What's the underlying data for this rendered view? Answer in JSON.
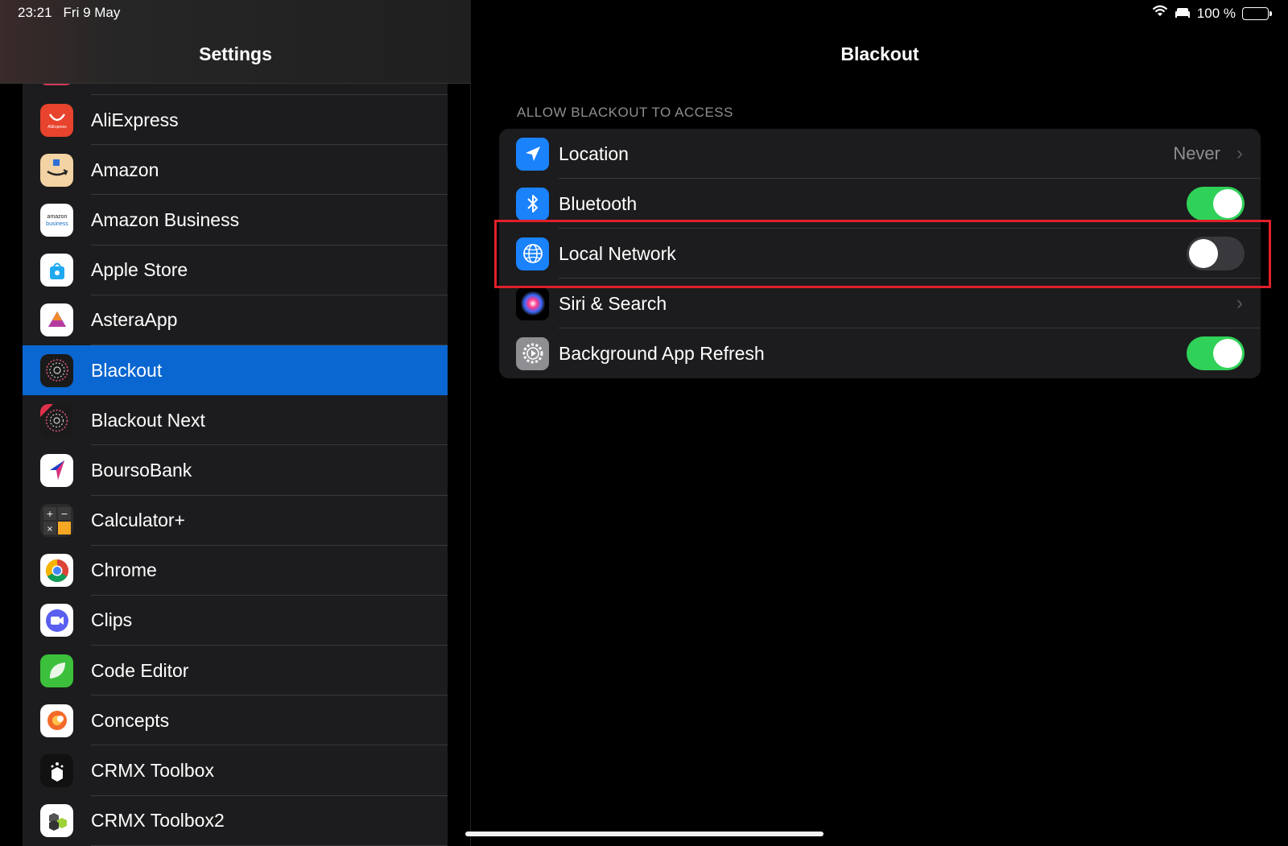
{
  "status_bar": {
    "time": "23:21",
    "date": "Fri 9 May",
    "battery_text": "100 %"
  },
  "sidebar": {
    "title": "Settings",
    "items": [
      {
        "label": "AliExpress",
        "icon": "aliexpress-icon",
        "color": "#e8432d"
      },
      {
        "label": "Amazon",
        "icon": "amazon-icon",
        "color": "#f3d3a3"
      },
      {
        "label": "Amazon Business",
        "icon": "amazon-business-icon",
        "color": "#ffffff",
        "icon_text": "amazon business"
      },
      {
        "label": "Apple Store",
        "icon": "apple-store-icon",
        "color": "#ffffff"
      },
      {
        "label": "AsteraApp",
        "icon": "astera-icon",
        "color": "#ffffff"
      },
      {
        "label": "Blackout",
        "icon": "blackout-icon",
        "color": "#1a1a1a",
        "selected": true
      },
      {
        "label": "Blackout Next",
        "icon": "blackout-next-icon",
        "color": "#1a1a1a"
      },
      {
        "label": "BoursoBank",
        "icon": "boursobank-icon",
        "color": "#ffffff"
      },
      {
        "label": "Calculator+",
        "icon": "calculator-icon",
        "color": "#2b2b2b"
      },
      {
        "label": "Chrome",
        "icon": "chrome-icon",
        "color": "#ffffff"
      },
      {
        "label": "Clips",
        "icon": "clips-icon",
        "color": "#ffffff"
      },
      {
        "label": "Code Editor",
        "icon": "code-editor-icon",
        "color": "#3cc03c"
      },
      {
        "label": "Concepts",
        "icon": "concepts-icon",
        "color": "#ffffff"
      },
      {
        "label": "CRMX Toolbox",
        "icon": "crmx-toolbox-icon",
        "color": "#111111"
      },
      {
        "label": "CRMX Toolbox2",
        "icon": "crmx-toolbox2-icon",
        "color": "#ffffff"
      }
    ]
  },
  "detail": {
    "title": "Blackout",
    "section_header": "ALLOW BLACKOUT TO ACCESS",
    "rows": [
      {
        "label": "Location",
        "value": "Never",
        "kind": "disclosure",
        "icon": "location-arrow-icon",
        "color": "#1a82fb"
      },
      {
        "label": "Bluetooth",
        "kind": "toggle",
        "on": true,
        "icon": "bluetooth-icon",
        "color": "#1a82fb"
      },
      {
        "label": "Local Network",
        "kind": "toggle",
        "on": false,
        "icon": "globe-icon",
        "color": "#1a82fb",
        "highlighted": true
      },
      {
        "label": "Siri & Search",
        "kind": "disclosure",
        "icon": "siri-icon",
        "color": "#000000"
      },
      {
        "label": "Background App Refresh",
        "kind": "toggle",
        "on": true,
        "icon": "gear-icon",
        "color": "#8e8e93"
      }
    ]
  },
  "colors": {
    "accent": "#0a66d0",
    "toggle_on": "#30d158",
    "highlight": "#e0202a"
  }
}
